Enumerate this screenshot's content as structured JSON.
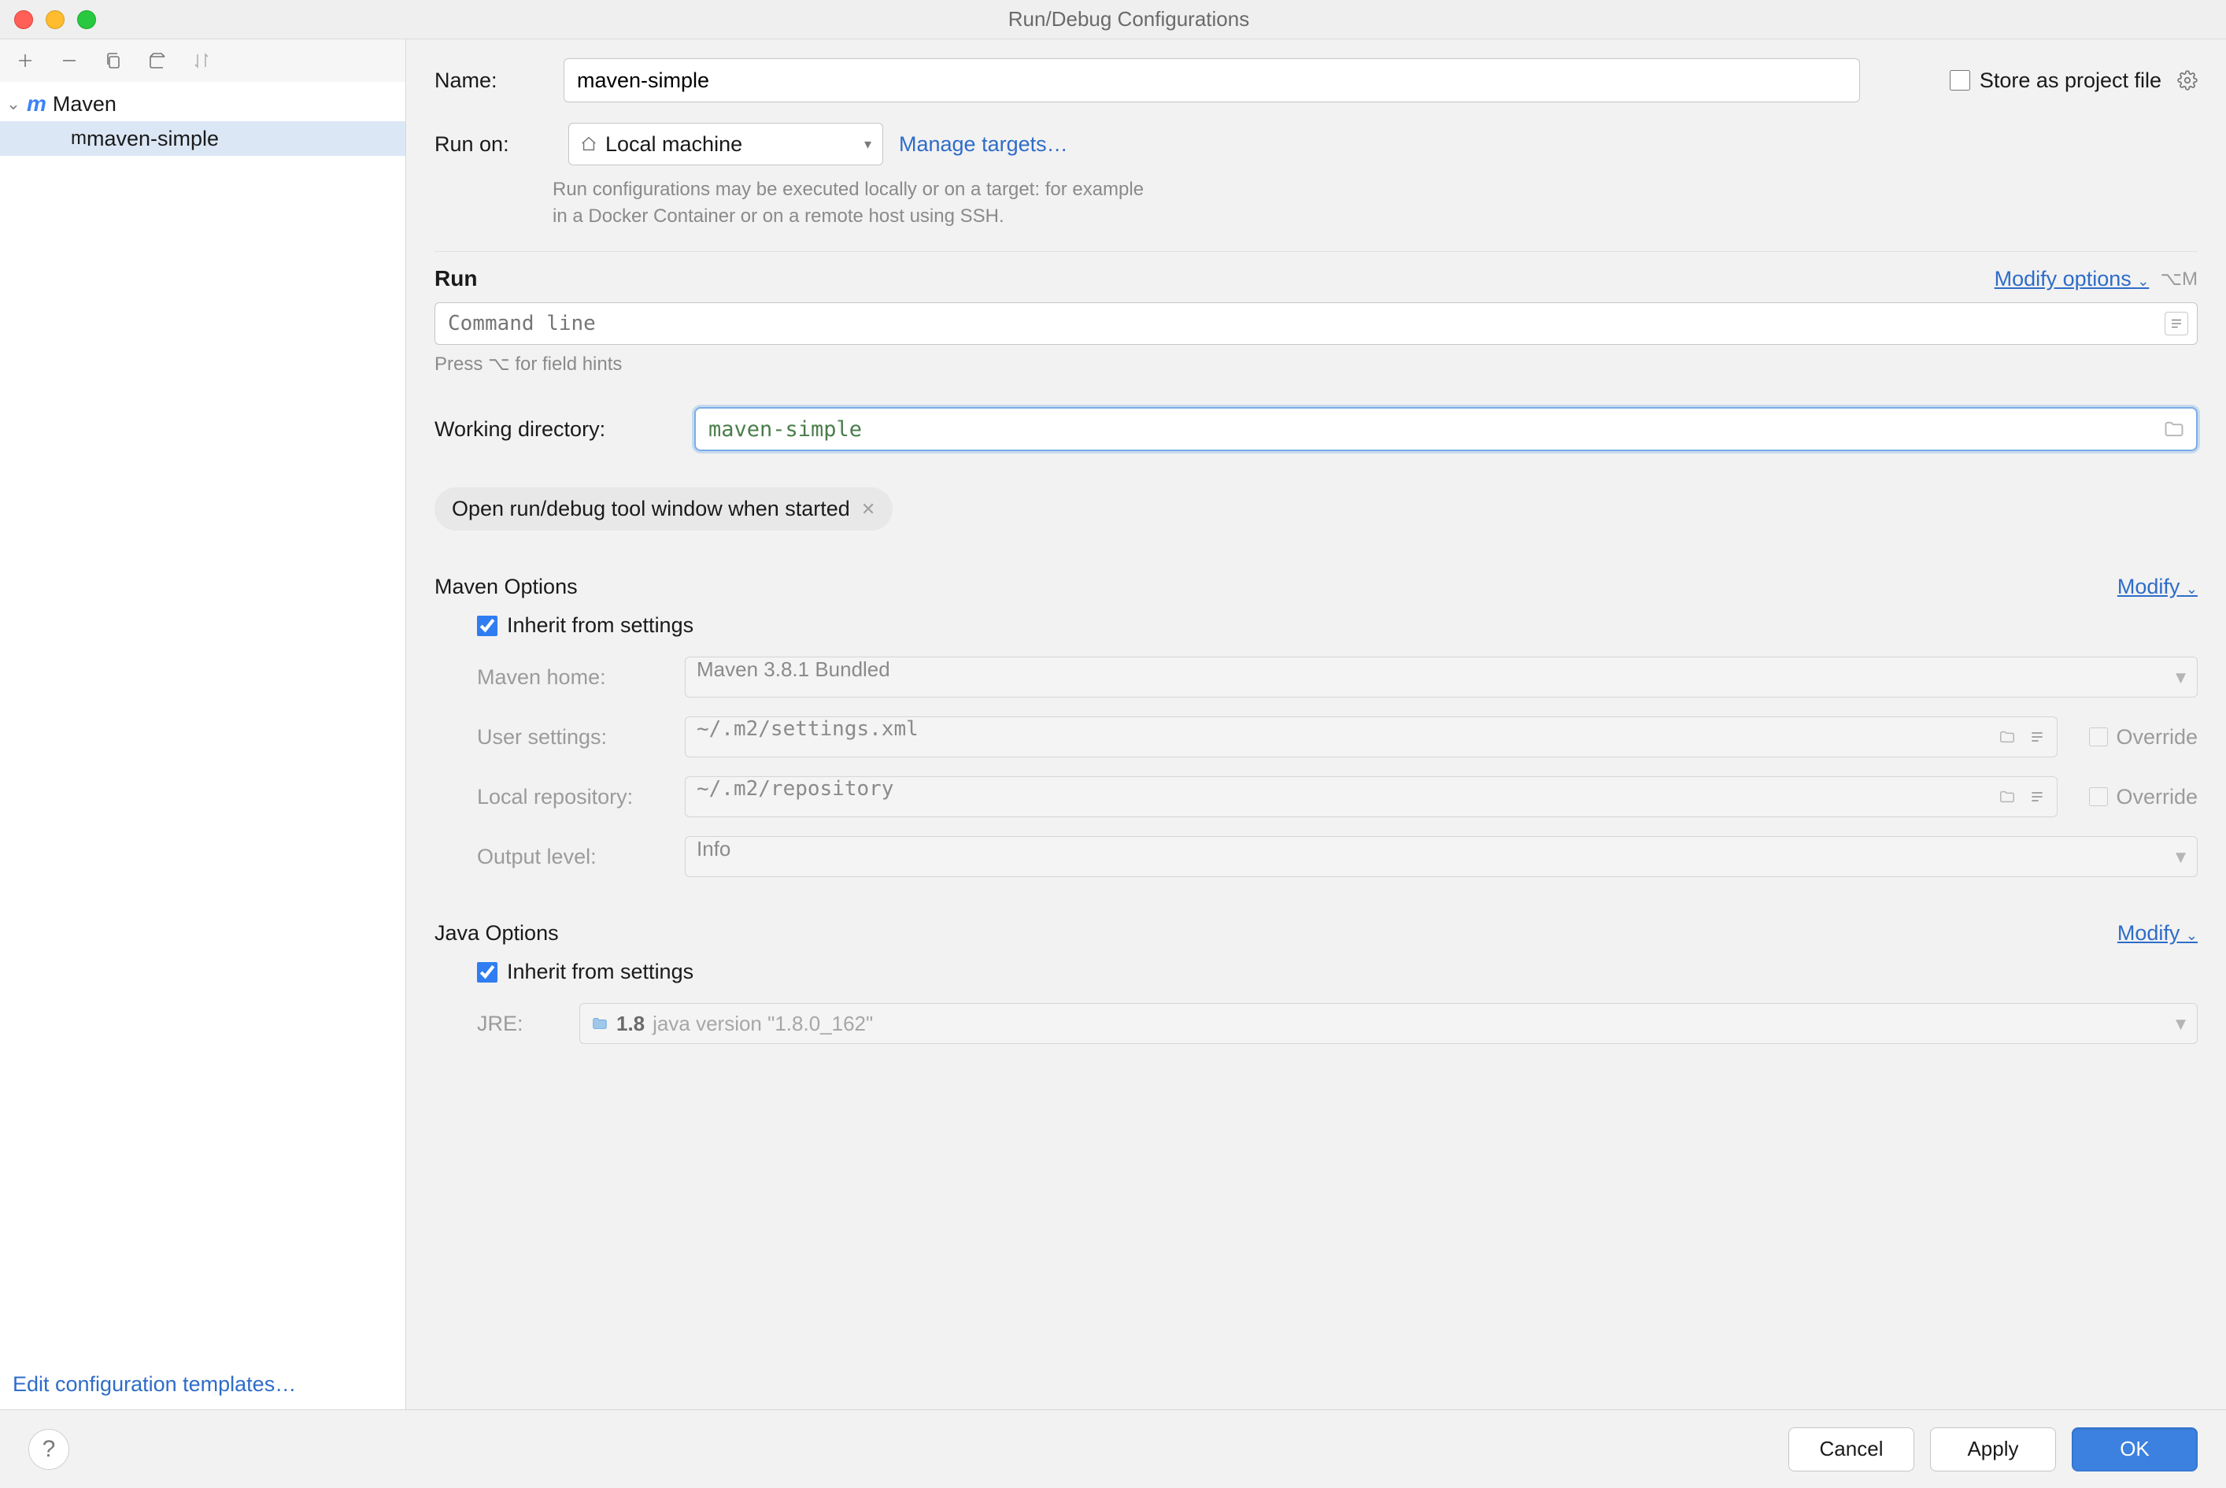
{
  "window": {
    "title": "Run/Debug Configurations"
  },
  "sidebar": {
    "root": {
      "label": "Maven"
    },
    "items": [
      {
        "label": "maven-simple"
      }
    ],
    "edit_templates": "Edit configuration templates…"
  },
  "form": {
    "name_label": "Name:",
    "name_value": "maven-simple",
    "store_label": "Store as project file",
    "runon_label": "Run on:",
    "runon_value": "Local machine",
    "manage_targets": "Manage targets…",
    "note_line1": "Run configurations may be executed locally or on a target: for example",
    "note_line2": "in a Docker Container or on a remote host using SSH."
  },
  "run": {
    "title": "Run",
    "modify": "Modify options",
    "shortcut": "⌥M",
    "cmd_placeholder": "Command line",
    "hint": "Press ⌥ for field hints",
    "wd_label": "Working directory:",
    "wd_value": "maven-simple",
    "pill": "Open run/debug tool window when started"
  },
  "maven": {
    "title": "Maven Options",
    "modify": "Modify",
    "inherit": "Inherit from settings",
    "home_label": "Maven home:",
    "home_value": "Maven 3.8.1 Bundled",
    "user_label": "User settings:",
    "user_value": "~/.m2/settings.xml",
    "local_label": "Local repository:",
    "local_value": "~/.m2/repository",
    "output_label": "Output level:",
    "output_value": "Info",
    "override": "Override"
  },
  "java": {
    "title": "Java Options",
    "modify": "Modify",
    "inherit": "Inherit from settings",
    "jre_label": "JRE:",
    "jre_version": "1.8",
    "jre_desc": "java version \"1.8.0_162\""
  },
  "footer": {
    "cancel": "Cancel",
    "apply": "Apply",
    "ok": "OK"
  }
}
